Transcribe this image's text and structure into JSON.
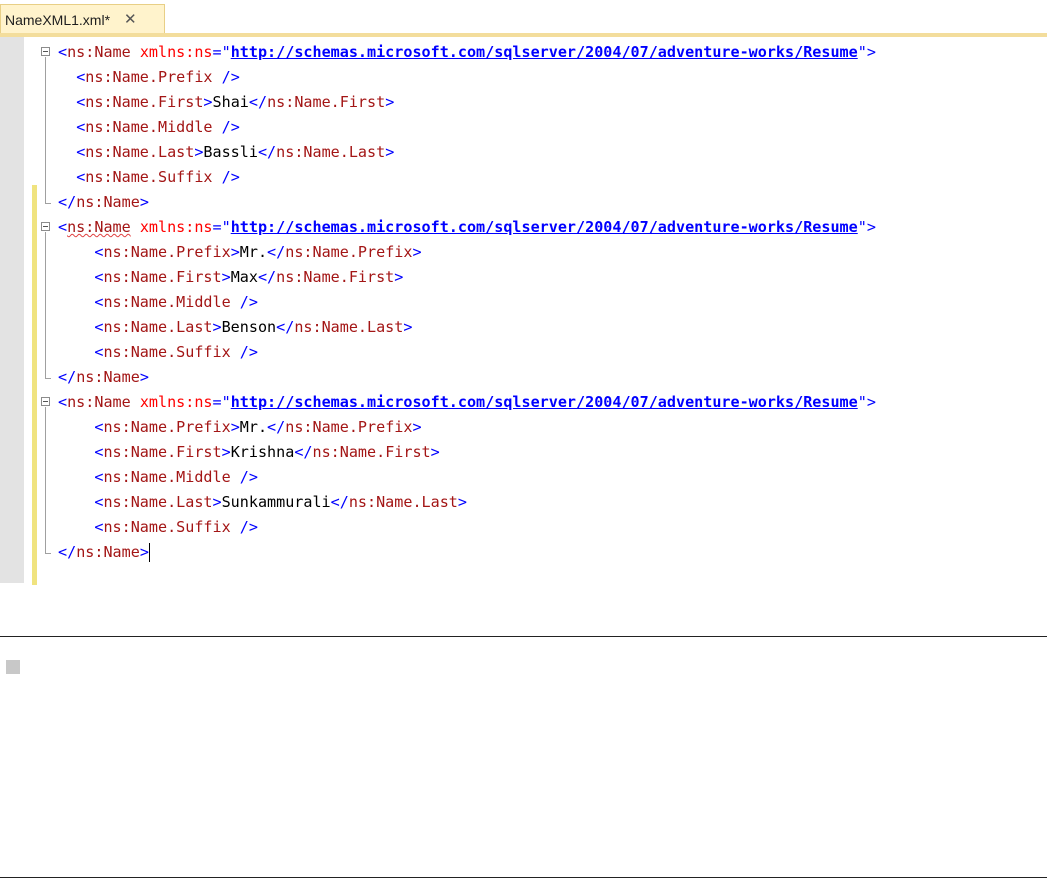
{
  "tab": {
    "title": "NameXML1.xml*",
    "close_glyph": "✕"
  },
  "ns_url": "http://schemas.microsoft.com/sqlserver/2004/07/adventure-works/Resume",
  "records": [
    {
      "prefix_text": "",
      "first": "Shai",
      "last": "Bassli"
    },
    {
      "prefix_text": "Mr.",
      "first": "Max",
      "last": "Benson"
    },
    {
      "prefix_text": "Mr.",
      "first": "Krishna",
      "last": "Sunkammurali"
    }
  ]
}
